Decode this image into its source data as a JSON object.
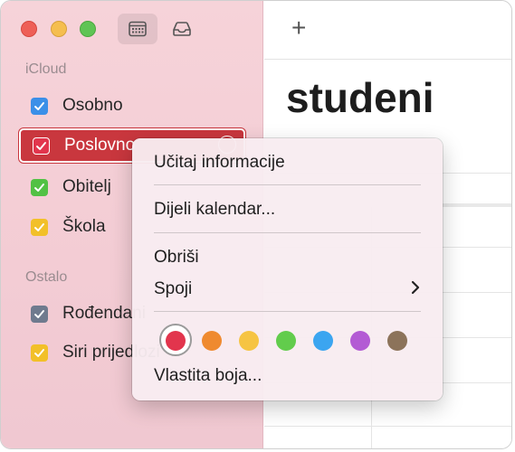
{
  "sidebar": {
    "sections": [
      {
        "label": "iCloud"
      },
      {
        "label": "Ostalo"
      }
    ],
    "calendars": [
      {
        "name": "Osobno",
        "color": "#3b8fe8"
      },
      {
        "name": "Poslovno",
        "color": "#e2354d"
      },
      {
        "name": "Obitelj",
        "color": "#52c144"
      },
      {
        "name": "Škola",
        "color": "#f2c029"
      },
      {
        "name": "Rođendani",
        "color": "#6f7a8e"
      },
      {
        "name": "Siri prijedlozi",
        "color": "#f2c029"
      }
    ]
  },
  "toolbar": {
    "add_label": "+"
  },
  "main": {
    "month_title": "studeni"
  },
  "context_menu": {
    "items": {
      "get_info": "Učitaj informacije",
      "share": "Dijeli kalendar...",
      "delete": "Obriši",
      "merge": "Spoji",
      "custom_color": "Vlastita boja..."
    },
    "colors": [
      "#e2354d",
      "#ef8a2f",
      "#f6c443",
      "#62cc4c",
      "#3ba5f0",
      "#b35bd4",
      "#8c735a"
    ],
    "selected_color": "#e2354d"
  }
}
